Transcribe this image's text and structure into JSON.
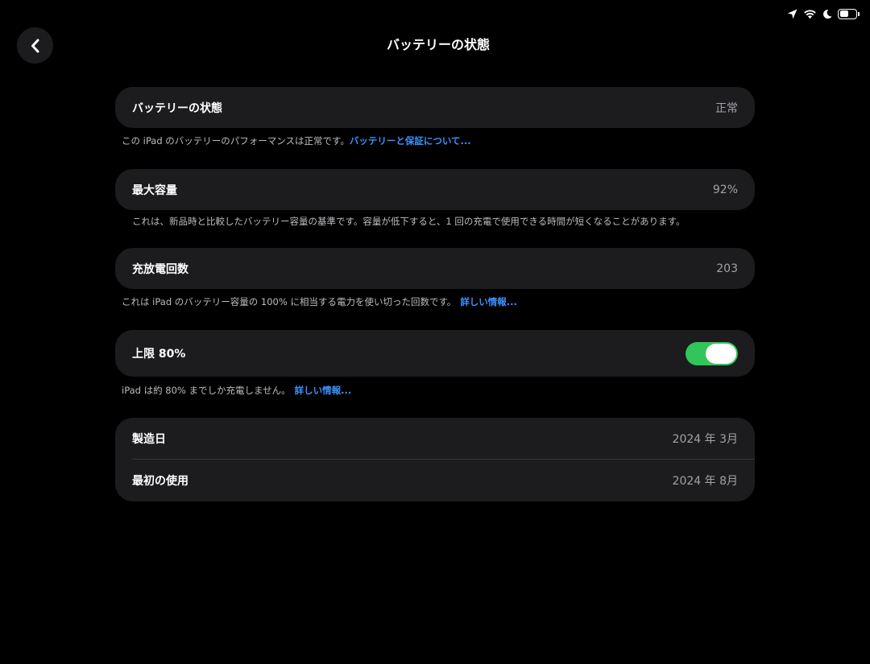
{
  "status_bar": {
    "icons": [
      "location-arrow-icon",
      "wifi-icon",
      "moon-icon",
      "battery-icon"
    ]
  },
  "header": {
    "back_icon": "chevron-left-icon",
    "title": "バッテリーの状態"
  },
  "battery_health": {
    "label": "バッテリーの状態",
    "value": "正常",
    "footnote_text": "この iPad のバッテリーのパフォーマンスは正常です。",
    "footnote_link": "バッテリーと保証について..."
  },
  "max_capacity": {
    "label": "最大容量",
    "value": "92%",
    "footnote_text": "これは、新品時と比較したバッテリー容量の基準です。容量が低下すると、1 回の充電で使用できる時間が短くなることがあります。"
  },
  "cycle_count": {
    "label": "充放電回数",
    "value": "203",
    "footnote_text": "これは iPad のバッテリー容量の 100% に相当する電力を使い切った回数です。",
    "footnote_link": "詳しい情報..."
  },
  "limit_80": {
    "label": "上限 80%",
    "enabled": true,
    "footnote_text": "iPad は約 80% までしか充電しません。",
    "footnote_link": "詳しい情報..."
  },
  "dates": {
    "manufacture_label": "製造日",
    "manufacture_value": "2024 年 3月",
    "first_use_label": "最初の使用",
    "first_use_value": "2024 年 8月"
  },
  "colors": {
    "background": "#000000",
    "card": "#1c1c1e",
    "link": "#3a93ff",
    "toggle_on": "#31c55a"
  }
}
